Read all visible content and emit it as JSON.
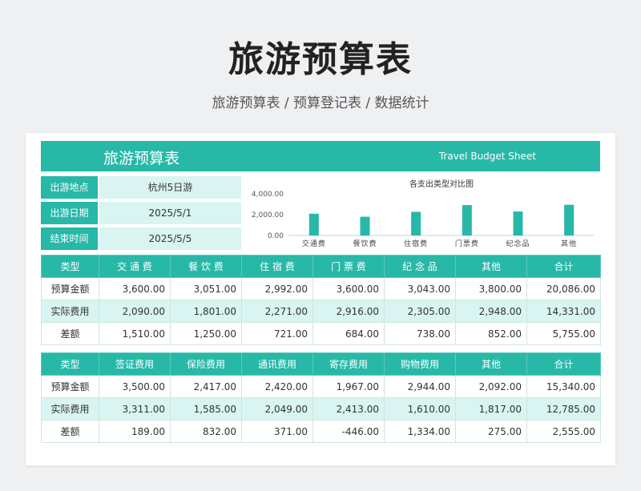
{
  "page": {
    "title": "旅游预算表",
    "subtitle": "旅游预算表 / 预算登记表 / 数据统计"
  },
  "banner": {
    "title": "旅游预算表",
    "title_en": "Travel Budget Sheet"
  },
  "info": [
    {
      "label": "出游地点",
      "value": "杭州5日游"
    },
    {
      "label": "出游日期",
      "value": "2025/5/1"
    },
    {
      "label": "结束时间",
      "value": "2025/5/5"
    }
  ],
  "colors": {
    "accent": "#27b8a8",
    "light": "#d9f4f1",
    "bar": "#27b8a8"
  },
  "chart_data": {
    "type": "bar",
    "title": "各支出类型对比图",
    "categories": [
      "交通费",
      "餐饮费",
      "住宿费",
      "门票费",
      "纪念品",
      "其他"
    ],
    "values": [
      2090,
      1801,
      2271,
      2916,
      2305,
      2948
    ],
    "y_ticks": [
      "4,000.00",
      "2,000.00",
      "0.00"
    ],
    "ylim": [
      0,
      4000
    ],
    "grid": false,
    "legend": "none"
  },
  "table1": {
    "headers": [
      "类型",
      "交 通 费",
      "餐 饮 费",
      "住 宿 费",
      "门 票 费",
      "纪 念 品",
      "其他",
      "合计"
    ],
    "rows": [
      {
        "label": "预算金额",
        "cells": [
          "3,600.00",
          "3,051.00",
          "2,992.00",
          "3,600.00",
          "3,043.00",
          "3,800.00",
          "20,086.00"
        ]
      },
      {
        "label": "实际费用",
        "cells": [
          "2,090.00",
          "1,801.00",
          "2,271.00",
          "2,916.00",
          "2,305.00",
          "2,948.00",
          "14,331.00"
        ]
      },
      {
        "label": "差额",
        "cells": [
          "1,510.00",
          "1,250.00",
          "721.00",
          "684.00",
          "738.00",
          "852.00",
          "5,755.00"
        ]
      }
    ]
  },
  "table2": {
    "headers": [
      "类型",
      "签证费用",
      "保险费用",
      "通讯费用",
      "寄存费用",
      "购物费用",
      "其他",
      "合计"
    ],
    "rows": [
      {
        "label": "预算金额",
        "cells": [
          "3,500.00",
          "2,417.00",
          "2,420.00",
          "1,967.00",
          "2,944.00",
          "2,092.00",
          "15,340.00"
        ]
      },
      {
        "label": "实际费用",
        "cells": [
          "3,311.00",
          "1,585.00",
          "2,049.00",
          "2,413.00",
          "1,610.00",
          "1,817.00",
          "12,785.00"
        ]
      },
      {
        "label": "差额",
        "cells": [
          "189.00",
          "832.00",
          "371.00",
          "-446.00",
          "1,334.00",
          "275.00",
          "2,555.00"
        ]
      }
    ]
  }
}
